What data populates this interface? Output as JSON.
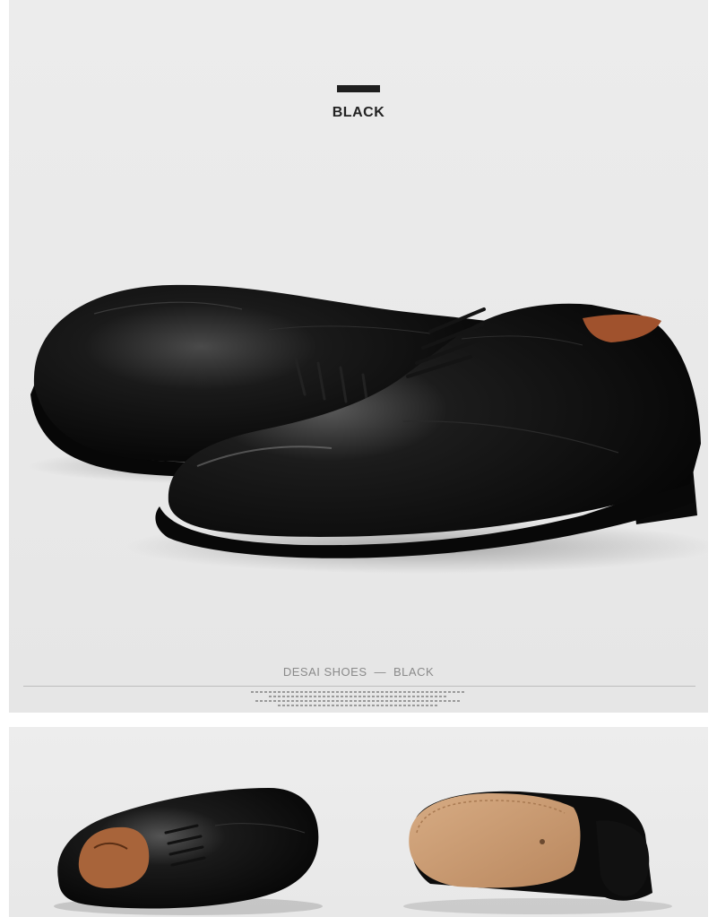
{
  "hero": {
    "color_label": "BLACK"
  },
  "caption": {
    "brand": "DESAI SHOES",
    "separator": "—",
    "color": "BLACK"
  },
  "colors": {
    "leather": "#0d0d0d",
    "panel": "#e9e9e9",
    "sole_tan": "#c89a73",
    "lining_brown": "#a0522d"
  }
}
